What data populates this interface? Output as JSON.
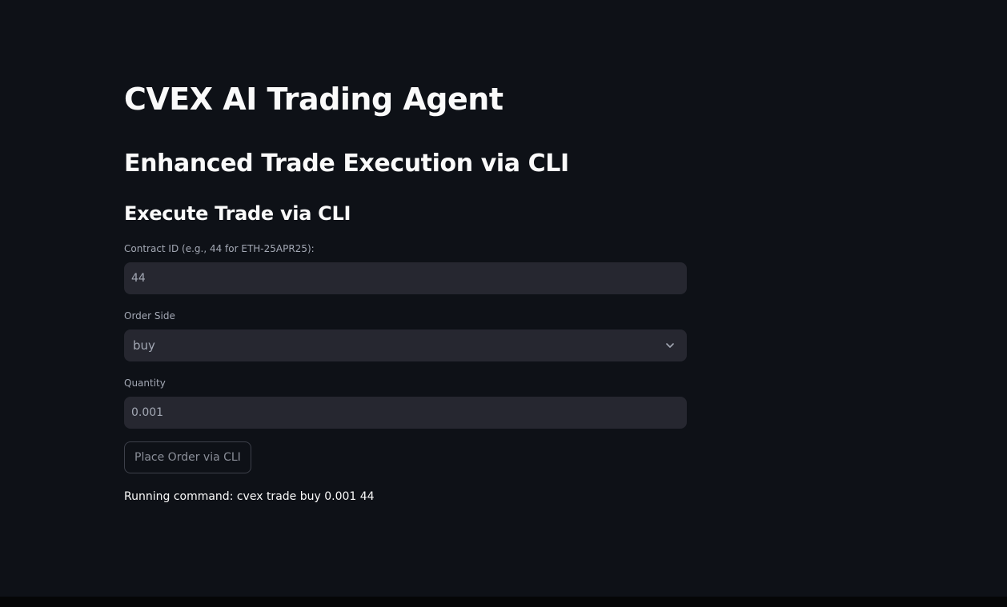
{
  "page": {
    "title": "CVEX AI Trading Agent",
    "subtitle": "Enhanced Trade Execution via CLI",
    "section_title": "Execute Trade via CLI"
  },
  "form": {
    "contract": {
      "label": "Contract ID (e.g., 44 for ETH-25APR25):",
      "value": "44"
    },
    "side": {
      "label": "Order Side",
      "value": "buy",
      "icon": "chevron-down-icon"
    },
    "quantity": {
      "label": "Quantity",
      "value": "0.001"
    },
    "submit_label": "Place Order via CLI"
  },
  "status": {
    "message": "Running command: cvex trade buy 0.001 44"
  },
  "colors": {
    "background": "#0e1117",
    "input_background": "#262730",
    "text": "#fafafa",
    "muted_text": "#a3a8b4"
  }
}
